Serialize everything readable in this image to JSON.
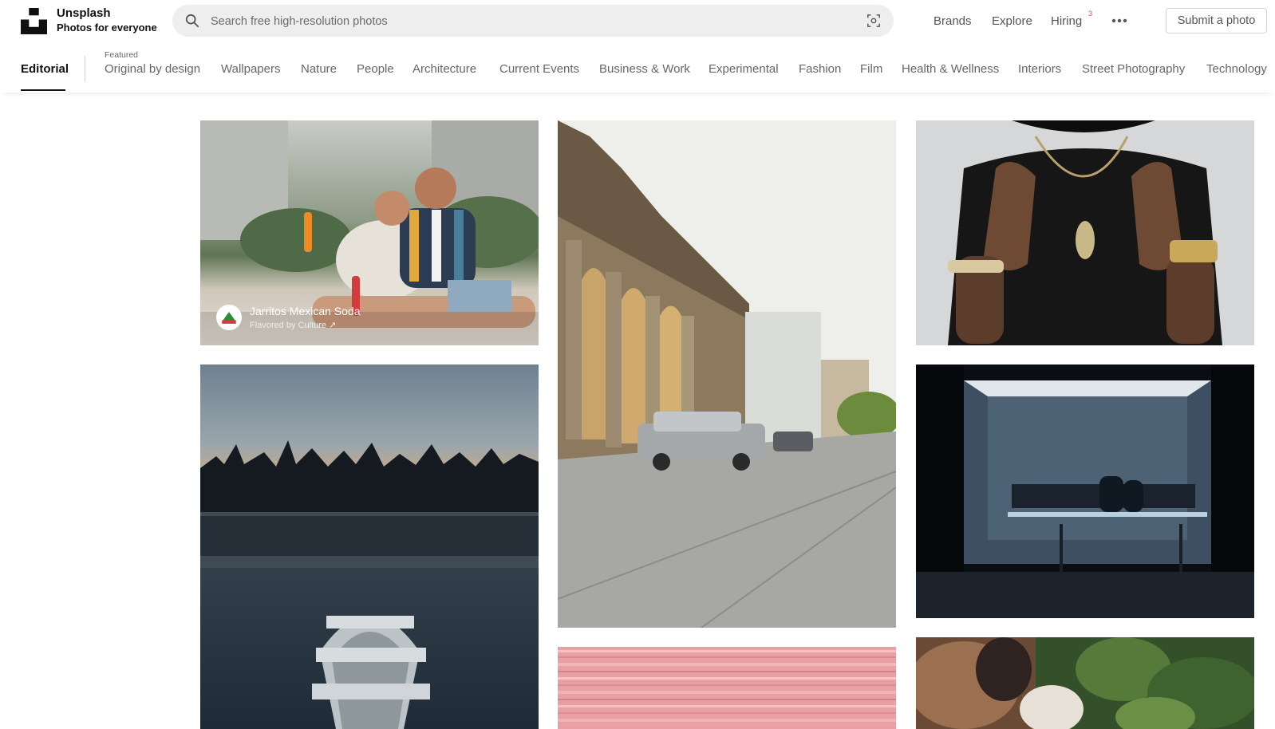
{
  "brand": {
    "name": "Unsplash",
    "tagline": "Photos for everyone"
  },
  "search": {
    "placeholder": "Search free high-resolution photos"
  },
  "nav": {
    "brands": "Brands",
    "explore": "Explore",
    "hiring": "Hiring",
    "hiring_badge": "3",
    "submit": "Submit a photo"
  },
  "topics": {
    "active": "Editorial",
    "featured_label": "Featured",
    "items": [
      "Original by design",
      "Wallpapers",
      "Nature",
      "People",
      "Architecture",
      "Current Events",
      "Business & Work",
      "Experimental",
      "Fashion",
      "Film",
      "Health & Wellness",
      "Interiors",
      "Street Photography",
      "Technology"
    ]
  },
  "sponsor": {
    "name": "Jarritos Mexican Soda",
    "subtitle": "Flavored by Culture ↗"
  },
  "colors": {
    "badge": "#d63a8a",
    "search_bg": "#eeeeee"
  }
}
